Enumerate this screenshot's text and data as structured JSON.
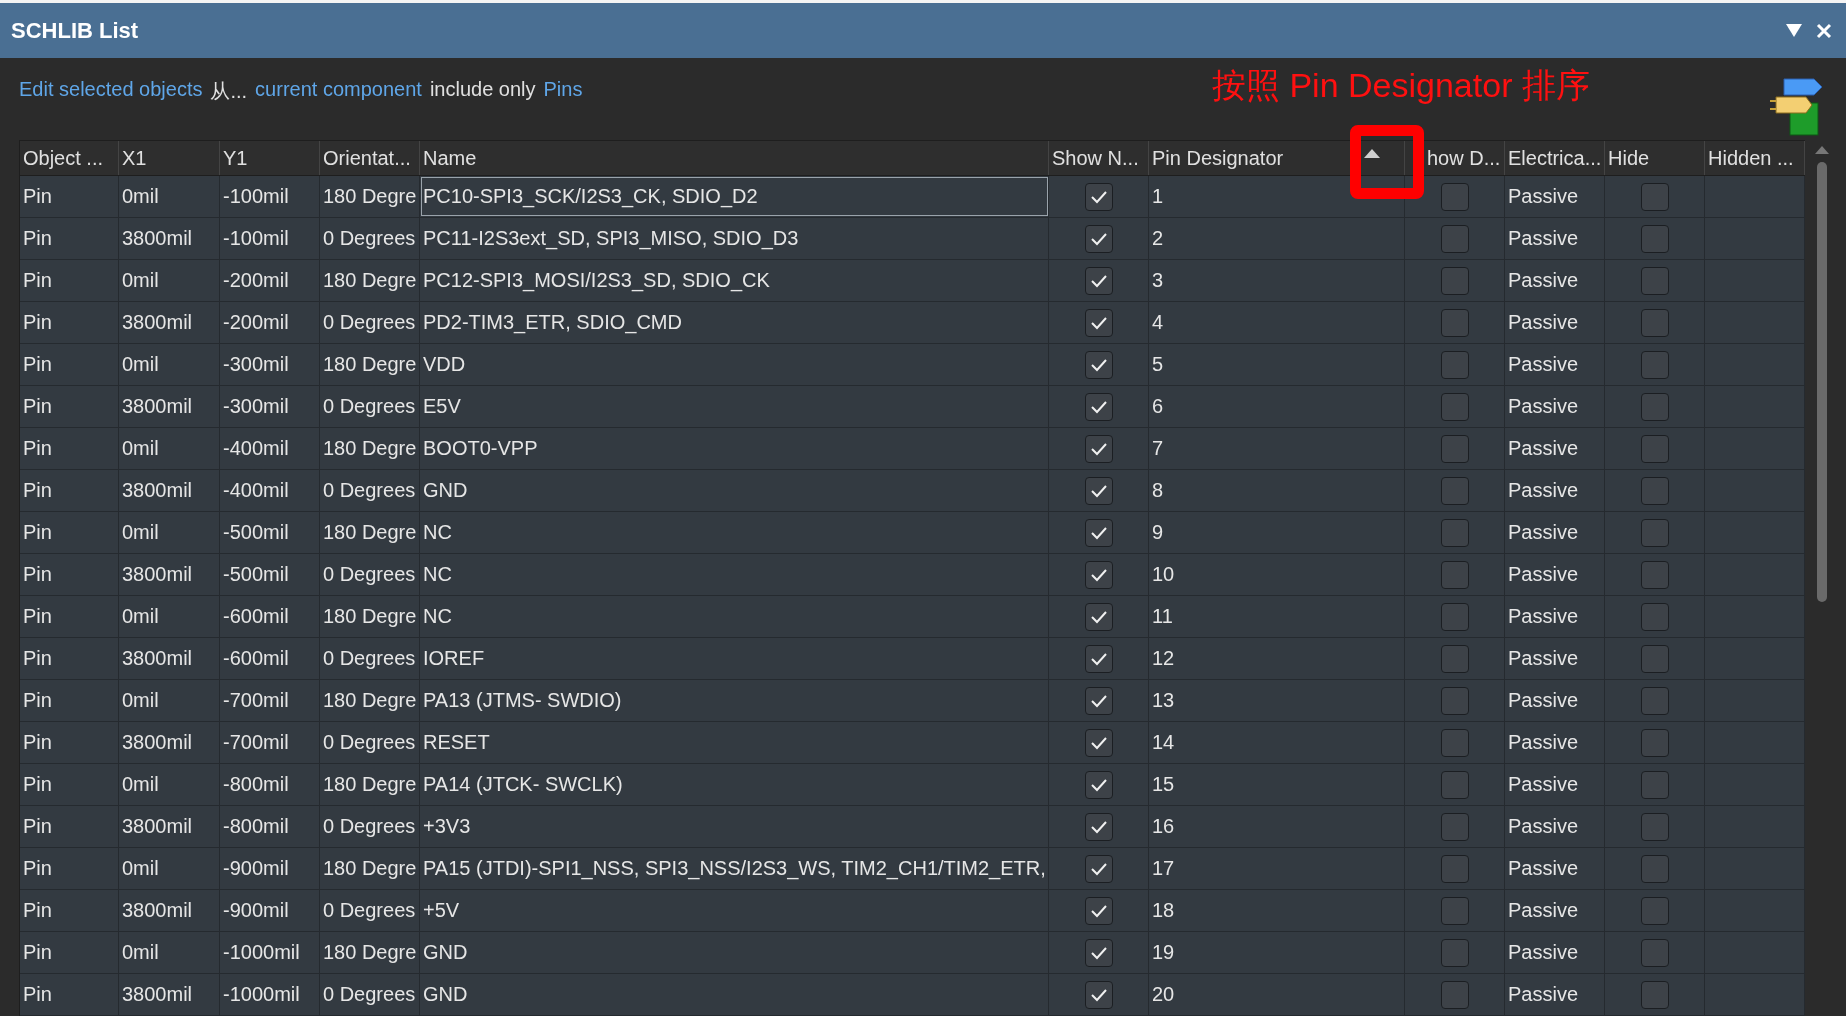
{
  "window": {
    "title": "SCHLIB List"
  },
  "filter_bar": [
    {
      "text": "Edit selected objects",
      "kind": "link"
    },
    {
      "text": "从...",
      "kind": "text"
    },
    {
      "text": "current component",
      "kind": "link"
    },
    {
      "text": "include only",
      "kind": "text"
    },
    {
      "text": "Pins",
      "kind": "link"
    }
  ],
  "annotation": {
    "text": "按照 Pin Designator 排序"
  },
  "table": {
    "columns": [
      "Object ...",
      "X1",
      "Y1",
      "Orientat...",
      "Name",
      "Show N...",
      "Pin Designator",
      "how D...",
      "Electrica...",
      "Hide",
      "Hidden ..."
    ],
    "sort_ascending": true,
    "rows": [
      {
        "object": "Pin",
        "x1": "0mil",
        "y1": "-100mil",
        "orientation": "180 Degre",
        "name": "PC10-SPI3_SCK/I2S3_CK, SDIO_D2",
        "show_name": true,
        "designator": "1",
        "show_designator": false,
        "electrical": "Passive",
        "hide": false,
        "focused": true
      },
      {
        "object": "Pin",
        "x1": "3800mil",
        "y1": "-100mil",
        "orientation": "0 Degrees",
        "name": "PC11-I2S3ext_SD, SPI3_MISO, SDIO_D3",
        "show_name": true,
        "designator": "2",
        "show_designator": false,
        "electrical": "Passive",
        "hide": false,
        "focused": false
      },
      {
        "object": "Pin",
        "x1": "0mil",
        "y1": "-200mil",
        "orientation": "180 Degre",
        "name": "PC12-SPI3_MOSI/I2S3_SD, SDIO_CK",
        "show_name": true,
        "designator": "3",
        "show_designator": false,
        "electrical": "Passive",
        "hide": false,
        "focused": false
      },
      {
        "object": "Pin",
        "x1": "3800mil",
        "y1": "-200mil",
        "orientation": "0 Degrees",
        "name": "PD2-TIM3_ETR, SDIO_CMD",
        "show_name": true,
        "designator": "4",
        "show_designator": false,
        "electrical": "Passive",
        "hide": false,
        "focused": false
      },
      {
        "object": "Pin",
        "x1": "0mil",
        "y1": "-300mil",
        "orientation": "180 Degre",
        "name": "VDD",
        "show_name": true,
        "designator": "5",
        "show_designator": false,
        "electrical": "Passive",
        "hide": false,
        "focused": false
      },
      {
        "object": "Pin",
        "x1": "3800mil",
        "y1": "-300mil",
        "orientation": "0 Degrees",
        "name": "E5V",
        "show_name": true,
        "designator": "6",
        "show_designator": false,
        "electrical": "Passive",
        "hide": false,
        "focused": false
      },
      {
        "object": "Pin",
        "x1": "0mil",
        "y1": "-400mil",
        "orientation": "180 Degre",
        "name": "BOOT0-VPP",
        "show_name": true,
        "designator": "7",
        "show_designator": false,
        "electrical": "Passive",
        "hide": false,
        "focused": false
      },
      {
        "object": "Pin",
        "x1": "3800mil",
        "y1": "-400mil",
        "orientation": "0 Degrees",
        "name": "GND",
        "show_name": true,
        "designator": "8",
        "show_designator": false,
        "electrical": "Passive",
        "hide": false,
        "focused": false
      },
      {
        "object": "Pin",
        "x1": "0mil",
        "y1": "-500mil",
        "orientation": "180 Degre",
        "name": "NC",
        "show_name": true,
        "designator": "9",
        "show_designator": false,
        "electrical": "Passive",
        "hide": false,
        "focused": false
      },
      {
        "object": "Pin",
        "x1": "3800mil",
        "y1": "-500mil",
        "orientation": "0 Degrees",
        "name": "NC",
        "show_name": true,
        "designator": "10",
        "show_designator": false,
        "electrical": "Passive",
        "hide": false,
        "focused": false
      },
      {
        "object": "Pin",
        "x1": "0mil",
        "y1": "-600mil",
        "orientation": "180 Degre",
        "name": "NC",
        "show_name": true,
        "designator": "11",
        "show_designator": false,
        "electrical": "Passive",
        "hide": false,
        "focused": false
      },
      {
        "object": "Pin",
        "x1": "3800mil",
        "y1": "-600mil",
        "orientation": "0 Degrees",
        "name": "IOREF",
        "show_name": true,
        "designator": "12",
        "show_designator": false,
        "electrical": "Passive",
        "hide": false,
        "focused": false
      },
      {
        "object": "Pin",
        "x1": "0mil",
        "y1": "-700mil",
        "orientation": "180 Degre",
        "name": "PA13 (JTMS- SWDIO)",
        "show_name": true,
        "designator": "13",
        "show_designator": false,
        "electrical": "Passive",
        "hide": false,
        "focused": false
      },
      {
        "object": "Pin",
        "x1": "3800mil",
        "y1": "-700mil",
        "orientation": "0 Degrees",
        "name": "RESET",
        "show_name": true,
        "designator": "14",
        "show_designator": false,
        "electrical": "Passive",
        "hide": false,
        "focused": false
      },
      {
        "object": "Pin",
        "x1": "0mil",
        "y1": "-800mil",
        "orientation": "180 Degre",
        "name": "PA14 (JTCK- SWCLK)",
        "show_name": true,
        "designator": "15",
        "show_designator": false,
        "electrical": "Passive",
        "hide": false,
        "focused": false
      },
      {
        "object": "Pin",
        "x1": "3800mil",
        "y1": "-800mil",
        "orientation": "0 Degrees",
        "name": "+3V3",
        "show_name": true,
        "designator": "16",
        "show_designator": false,
        "electrical": "Passive",
        "hide": false,
        "focused": false
      },
      {
        "object": "Pin",
        "x1": "0mil",
        "y1": "-900mil",
        "orientation": "180 Degre",
        "name": "PA15 (JTDI)-SPI1_NSS, SPI3_NSS/I2S3_WS, TIM2_CH1/TIM2_ETR,",
        "show_name": true,
        "designator": "17",
        "show_designator": false,
        "electrical": "Passive",
        "hide": false,
        "focused": false
      },
      {
        "object": "Pin",
        "x1": "3800mil",
        "y1": "-900mil",
        "orientation": "0 Degrees",
        "name": "+5V",
        "show_name": true,
        "designator": "18",
        "show_designator": false,
        "electrical": "Passive",
        "hide": false,
        "focused": false
      },
      {
        "object": "Pin",
        "x1": "0mil",
        "y1": "-1000mil",
        "orientation": "180 Degre",
        "name": "GND",
        "show_name": true,
        "designator": "19",
        "show_designator": false,
        "electrical": "Passive",
        "hide": false,
        "focused": false
      },
      {
        "object": "Pin",
        "x1": "3800mil",
        "y1": "-1000mil",
        "orientation": "0 Degrees",
        "name": "GND",
        "show_name": true,
        "designator": "20",
        "show_designator": false,
        "electrical": "Passive",
        "hide": false,
        "focused": false
      }
    ]
  }
}
